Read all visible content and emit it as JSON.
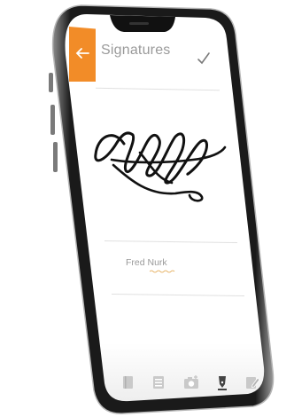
{
  "header": {
    "title": "Signatures",
    "back_icon": "arrow-left-icon",
    "confirm_icon": "check-icon",
    "accent_color": "#f28c28"
  },
  "signature": {
    "name": "Fred Nurk"
  },
  "tabbar": {
    "items": [
      {
        "icon": "book-icon"
      },
      {
        "icon": "list-icon"
      },
      {
        "icon": "camera-icon"
      },
      {
        "icon": "pen-icon",
        "active": true
      },
      {
        "icon": "edit-icon"
      }
    ]
  }
}
